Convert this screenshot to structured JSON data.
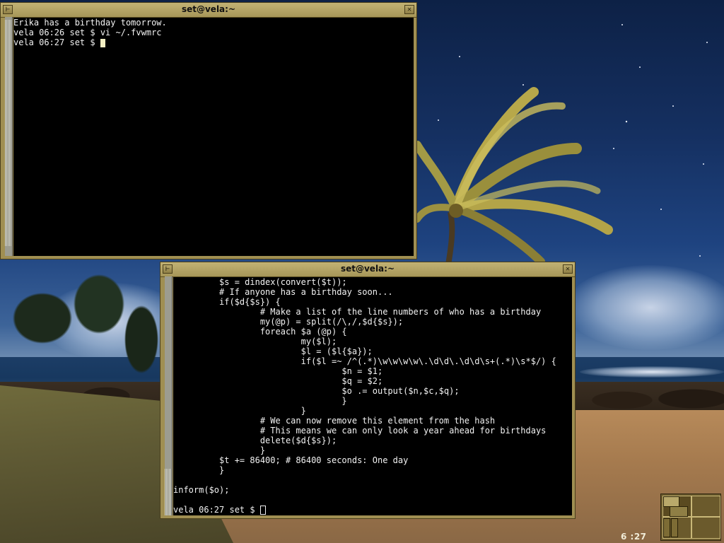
{
  "desktop": {
    "wallpaper": "beach-palm-night",
    "clock": "6 :27"
  },
  "windows": [
    {
      "title": "set@vela:~",
      "lines": [
        "Erika has a birthday tomorrow.",
        "vela 06:26 set $ vi ~/.fvwmrc"
      ],
      "prompt": "vela 06:27 set $ "
    },
    {
      "title": "set@vela:~",
      "lines": [
        "         $s = dindex(convert($t));",
        "         # If anyone has a birthday soon...",
        "         if($d{$s}) {",
        "                 # Make a list of the line numbers of who has a birthday",
        "                 my(@p) = split(/\\,/,$d{$s});",
        "                 foreach $a (@p) {",
        "                         my($l);",
        "                         $l = ($l{$a});",
        "                         if($l =~ /^(.*)\\w\\w\\w\\w\\.\\d\\d\\.\\d\\d\\s+(.*)\\s*$/) {",
        "                                 $n = $1;",
        "                                 $q = $2;",
        "                                 $o .= output($n,$c,$q);",
        "                                 }",
        "                         }",
        "                 # We can now remove this element from the hash",
        "                 # This means we can only look a year ahead for birthdays",
        "                 delete($d{$s});",
        "                 }",
        "         $t += 86400; # 86400 seconds: One day",
        "         }",
        "",
        "inform($o);",
        ""
      ],
      "prompt": "vela 06:27 set $ "
    }
  ],
  "colors": {
    "title_bar": "#a69658",
    "terminal_bg": "#000000",
    "terminal_fg": "#f2f2f2",
    "cursor": "#f4f0c4"
  }
}
